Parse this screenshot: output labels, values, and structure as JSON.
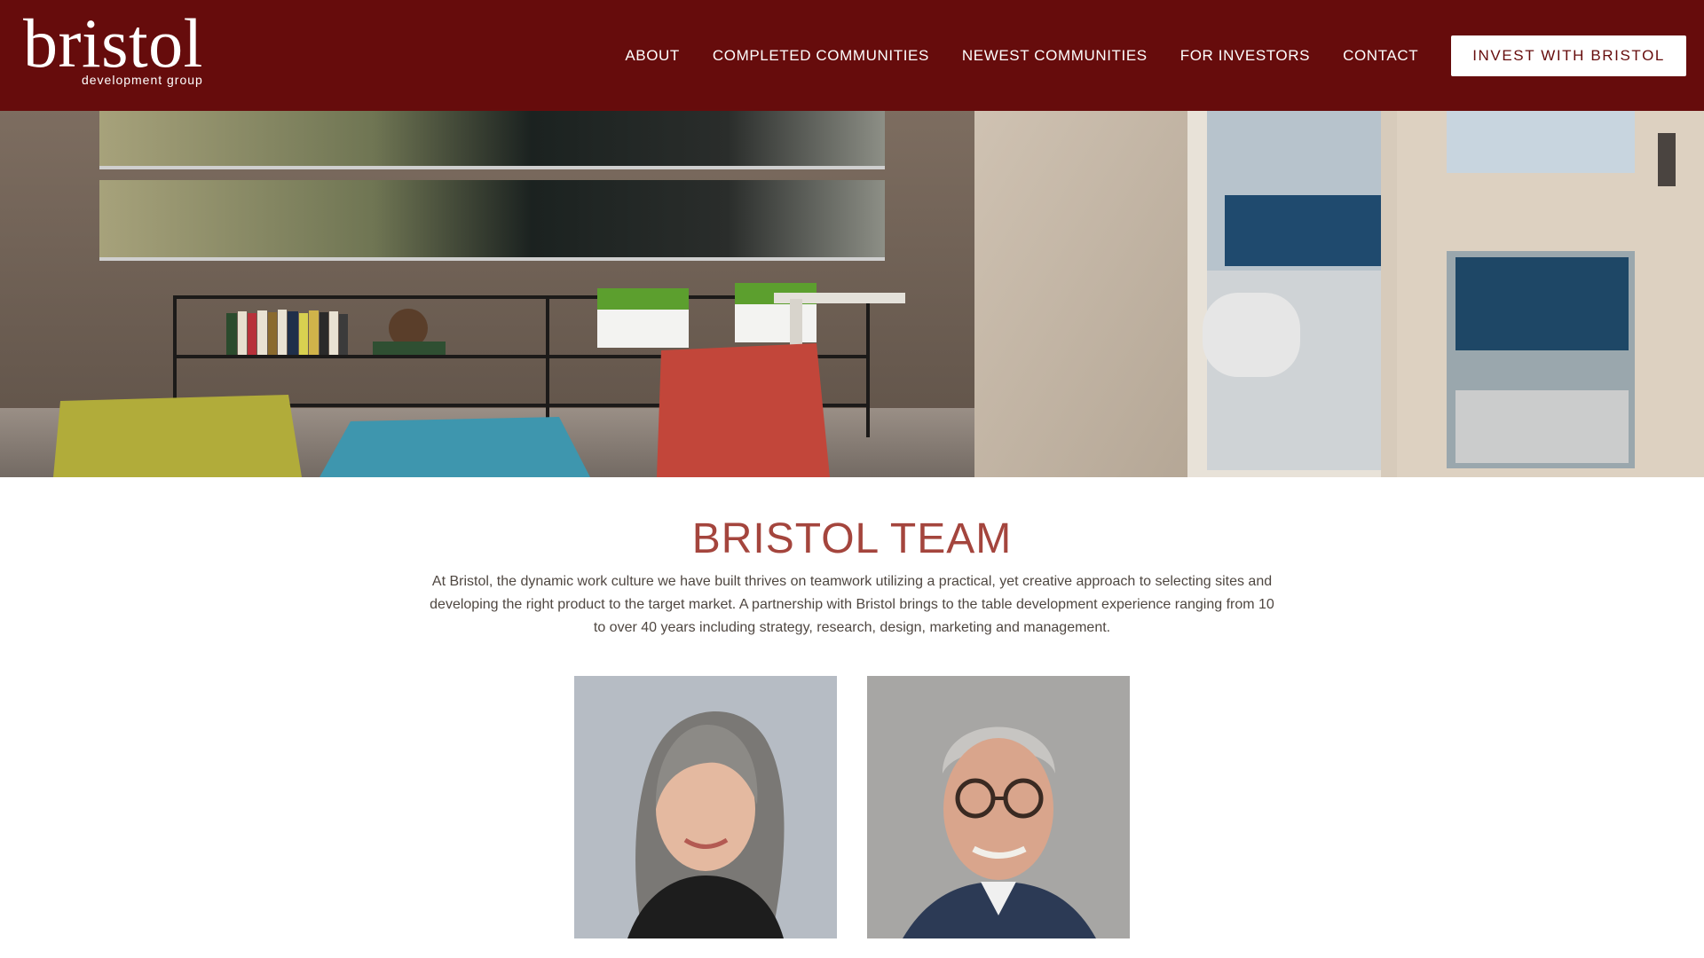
{
  "brand": {
    "name": "bristol",
    "tagline": "development group"
  },
  "nav": {
    "items": [
      {
        "label": "ABOUT"
      },
      {
        "label": "COMPLETED COMMUNITIES"
      },
      {
        "label": "NEWEST COMMUNITIES"
      },
      {
        "label": "FOR INVESTORS"
      },
      {
        "label": "CONTACT"
      }
    ],
    "cta": "INVEST WITH BRISTOL"
  },
  "page": {
    "title": "BRISTOL TEAM",
    "intro": "At Bristol, the dynamic work culture we have built thrives on teamwork utilizing a practical, yet creative approach to selecting sites and developing the right product to the target market. A partnership with Bristol brings to the table development experience ranging from 10 to over 40 years including strategy, research, design, marketing and management."
  },
  "team": {
    "members": [
      {
        "name": ""
      },
      {
        "name": ""
      }
    ]
  },
  "colors": {
    "header_bg": "#660c0c",
    "title": "#a4453d",
    "body_text": "#4f4741"
  }
}
